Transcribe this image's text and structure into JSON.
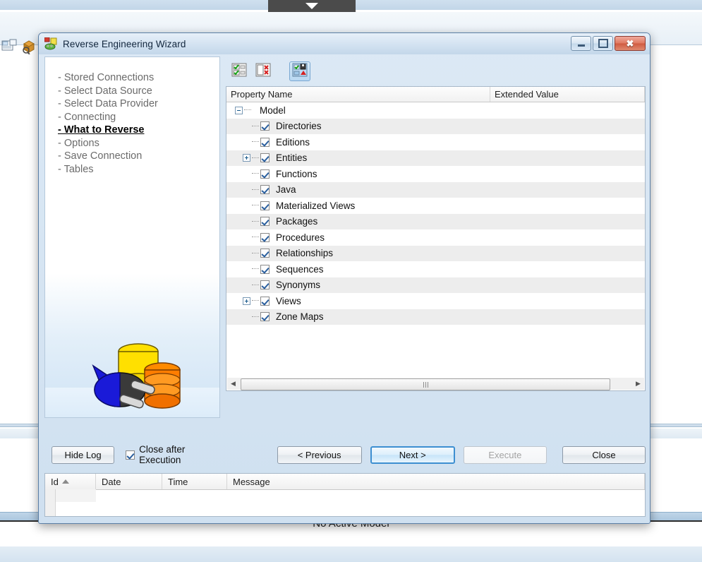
{
  "background": {
    "tab_chevron_icon": "chevron-down-icon",
    "toolbar_icons": [
      "document-window-icon",
      "package-search-icon"
    ],
    "status_text": "No Active Model"
  },
  "dialog": {
    "title": "Reverse Engineering Wizard",
    "title_icon": "reverse-engineering-icon",
    "window_controls": {
      "minimize": "minimize-icon",
      "maximize": "maximize-icon",
      "close": "close-icon"
    }
  },
  "sidebar": {
    "steps": [
      {
        "label": "- Stored Connections",
        "active": false
      },
      {
        "label": "- Select Data Source",
        "active": false
      },
      {
        "label": "- Select Data Provider",
        "active": false
      },
      {
        "label": "- Connecting",
        "active": false
      },
      {
        "label": "- What to Reverse",
        "active": true
      },
      {
        "label": "- Options",
        "active": false
      },
      {
        "label": "- Save Connection",
        "active": false
      },
      {
        "label": "- Tables",
        "active": false
      }
    ],
    "artwork": "database-plug-icon"
  },
  "toolbar": {
    "buttons": [
      {
        "name": "check-all-button",
        "icon": "check-all-icon",
        "selected": false
      },
      {
        "name": "uncheck-all-button",
        "icon": "uncheck-all-icon",
        "selected": false
      },
      {
        "name": "save-selection-button",
        "icon": "save-selection-icon",
        "selected": true
      }
    ]
  },
  "grid": {
    "columns": [
      "Property Name",
      "Extended Value"
    ],
    "root": {
      "label": "Model",
      "expander": "minus"
    },
    "rows": [
      {
        "label": "Directories",
        "checked": true,
        "expander": "none"
      },
      {
        "label": "Editions",
        "checked": true,
        "expander": "none"
      },
      {
        "label": "Entities",
        "checked": true,
        "expander": "plus"
      },
      {
        "label": "Functions",
        "checked": true,
        "expander": "none"
      },
      {
        "label": "Java",
        "checked": true,
        "expander": "none"
      },
      {
        "label": "Materialized Views",
        "checked": true,
        "expander": "none"
      },
      {
        "label": "Packages",
        "checked": true,
        "expander": "none"
      },
      {
        "label": "Procedures",
        "checked": true,
        "expander": "none"
      },
      {
        "label": "Relationships",
        "checked": true,
        "expander": "none"
      },
      {
        "label": "Sequences",
        "checked": true,
        "expander": "none"
      },
      {
        "label": "Synonyms",
        "checked": true,
        "expander": "none"
      },
      {
        "label": "Views",
        "checked": true,
        "expander": "plus"
      },
      {
        "label": "Zone Maps",
        "checked": true,
        "expander": "none"
      }
    ],
    "hscroll": {
      "left_arrow": "arrow-left-icon",
      "right_arrow": "arrow-right-icon"
    }
  },
  "buttons": {
    "hide_log": "Hide Log",
    "close_after_execution_label": "Close after Execution",
    "close_after_execution_checked": true,
    "previous": "< Previous",
    "next": "Next >",
    "execute": "Execute",
    "execute_disabled": true,
    "close": "Close"
  },
  "log": {
    "columns": [
      "Id",
      "Date",
      "Time",
      "Message"
    ],
    "sort_column": "Id",
    "sort_direction": "ascending",
    "rows": []
  }
}
